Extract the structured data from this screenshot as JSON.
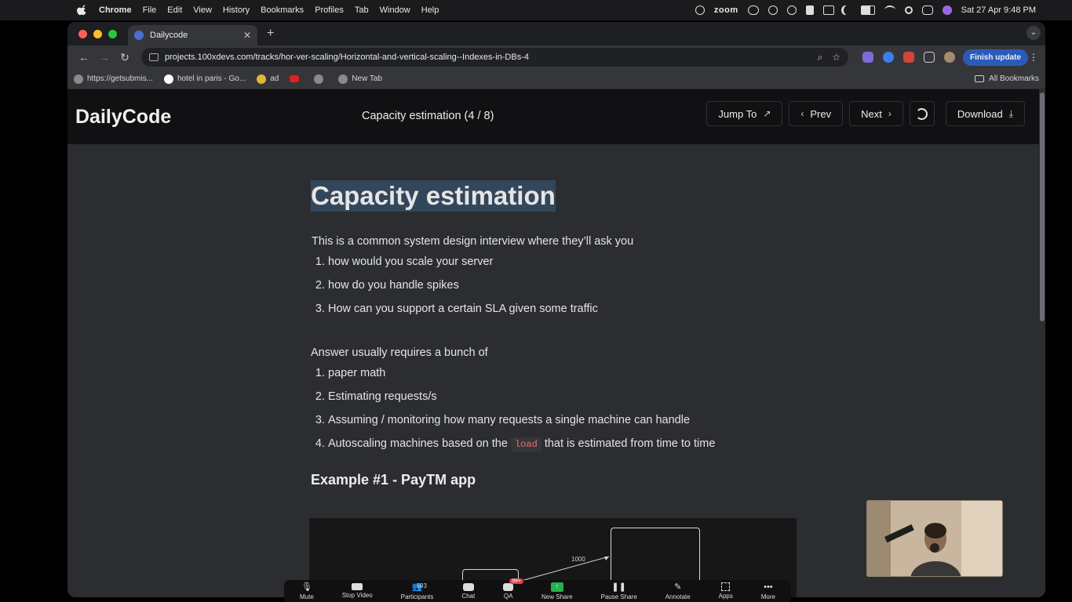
{
  "menubar": {
    "app": "Chrome",
    "items": [
      "File",
      "Edit",
      "View",
      "History",
      "Bookmarks",
      "Profiles",
      "Tab",
      "Window",
      "Help"
    ],
    "zoom": "zoom",
    "datetime": "Sat 27 Apr  9:48 PM"
  },
  "browser": {
    "tab_title": "Dailycode",
    "url": "projects.100xdevs.com/tracks/hor-ver-scaling/Horizontal-and-vertical-scaling--Indexes-in-DBs-4",
    "finish_update": "Finish update",
    "bookmarks": [
      "https://getsubmis...",
      "hotel in paris - Go...",
      "ad",
      "",
      "",
      "New Tab"
    ],
    "all_bookmarks": "All Bookmarks"
  },
  "app": {
    "brand": "DailyCode",
    "page_title": "Capacity estimation (4 / 8)",
    "buttons": {
      "jump": "Jump To",
      "prev": "Prev",
      "next": "Next",
      "download": "Download"
    }
  },
  "article": {
    "heading": "Capacity estimation",
    "intro": "This is a common system design interview where they’ll ask you",
    "questions": [
      "how would you scale your server",
      "how do you handle spikes",
      "How can you support a certain SLA given some traffic"
    ],
    "intro2": "Answer usually requires a bunch of",
    "answers": [
      "paper math",
      "Estimating requests/s",
      "Assuming / monitoring how many requests a single machine can handle"
    ],
    "answer4_before": "Autoscaling machines based on the",
    "answer4_code": "load",
    "answer4_after": "that is estimated from time to time",
    "example_heading": "Example #1 - PayTM app",
    "diagram_label": "1000"
  },
  "zoom_toolbar": {
    "items": [
      "Mute",
      "Stop Video",
      "Participants",
      "Chat",
      "QA",
      "New Share",
      "Pause Share",
      "Annotate",
      "Apps",
      "More"
    ],
    "participants_count": "593",
    "qa_badge": "99+"
  },
  "colors": {
    "page_bg": "#2b2d31",
    "header_bg": "#111113",
    "heading_highlight": "#33475b",
    "code_text": "#e57373",
    "finish_update_bg": "#2b5bb8"
  }
}
